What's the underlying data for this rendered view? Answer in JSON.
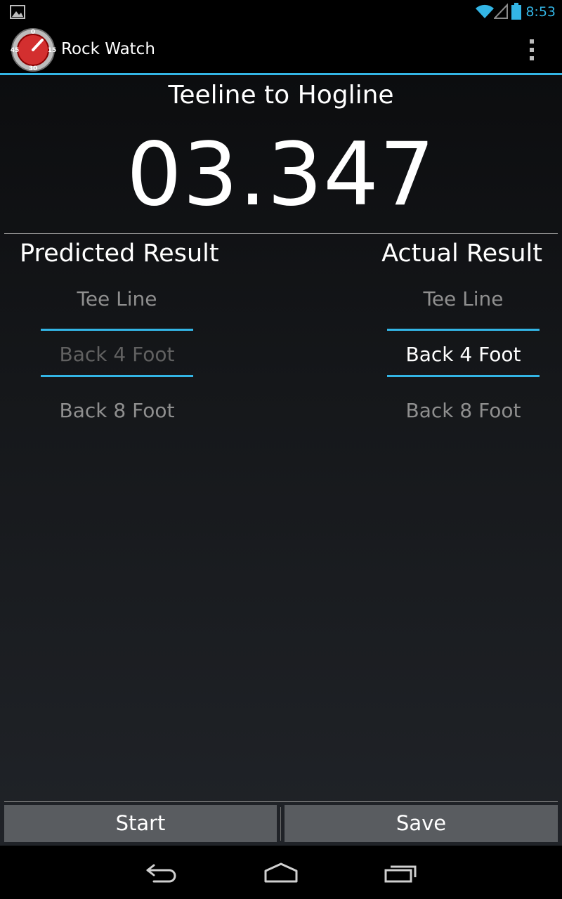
{
  "status_bar": {
    "time": "8:53",
    "icons": [
      "image-notification-icon",
      "wifi-icon",
      "signal-icon",
      "battery-icon"
    ],
    "accent_color": "#33b5e5"
  },
  "action_bar": {
    "title": "Rock Watch",
    "logo": {
      "dial_labels": [
        "0",
        "15",
        "30",
        "45"
      ],
      "dial_color": "#d32f2f"
    },
    "overflow_icon": "overflow-menu-icon"
  },
  "main": {
    "section_title": "Teeline to Hogline",
    "timer_value": "03.347",
    "predicted": {
      "header": "Predicted Result",
      "options": [
        "Tee Line",
        "Back 4 Foot",
        "Back 8 Foot"
      ],
      "selected": "Back 4 Foot"
    },
    "actual": {
      "header": "Actual Result",
      "options": [
        "Tee Line",
        "Back 4 Foot",
        "Back 8 Foot"
      ],
      "selected": "Back 4 Foot"
    }
  },
  "buttons": {
    "start_label": "Start",
    "save_label": "Save"
  },
  "nav_bar": {
    "icons": [
      "back-icon",
      "home-icon",
      "recents-icon"
    ]
  }
}
